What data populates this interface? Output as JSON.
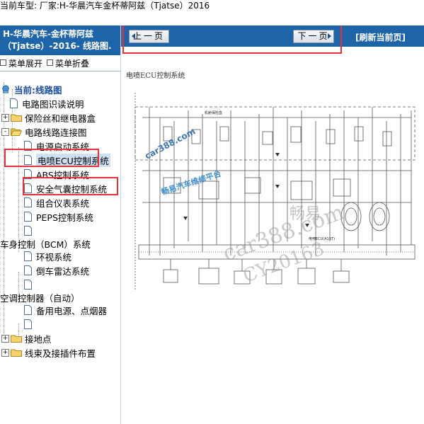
{
  "header": {
    "vehicle_text": "当前车型:  厂家:H-华晨汽车金杯蒂阿兹（Tjatse）2016"
  },
  "left_panel": {
    "title_line1": "H-华晨汽车-金杯蒂阿兹",
    "title_line2": "（Tjatse）-2016- 线路图.",
    "expand_label": "菜单展开",
    "collapse_label": "菜单折叠",
    "tree": [
      {
        "label": "当前:线路图",
        "type": "root"
      },
      {
        "label": "电路图识读说明",
        "type": "doc"
      },
      {
        "label": "保险丝和继电器盒",
        "type": "folder",
        "toggle": "+"
      },
      {
        "label": "电路线路连接图",
        "type": "folder-open",
        "toggle": "-"
      },
      {
        "label": "电源启动系统",
        "type": "doc"
      },
      {
        "label": "电喷ECU控制系统",
        "type": "doc"
      },
      {
        "label": "ABS控制系统",
        "type": "doc"
      },
      {
        "label": "安全气囊控制系统",
        "type": "doc"
      },
      {
        "label": "组合仪表系统",
        "type": "doc"
      },
      {
        "label": "PEPS控制系统",
        "type": "doc"
      },
      {
        "label": "",
        "type": "doc"
      },
      {
        "label": "车身控制（BCM）系统",
        "type": "text"
      },
      {
        "label": "环视系统",
        "type": "doc"
      },
      {
        "label": "倒车雷达系统",
        "type": "doc"
      },
      {
        "label": "",
        "type": "doc"
      },
      {
        "label": "空调控制器（自动）",
        "type": "text"
      },
      {
        "label": "备用电源、点烟器",
        "type": "doc"
      },
      {
        "label": "",
        "type": "doc"
      },
      {
        "label": "接地点",
        "type": "folder",
        "toggle": "+"
      },
      {
        "label": "线束及接插件布置",
        "type": "folder",
        "toggle": "+"
      }
    ]
  },
  "toolbar": {
    "prev_label": "上一页",
    "next_label": "下一页",
    "refresh_label": "[刷新当前页]"
  },
  "diagram": {
    "title": "电喷ECU控制系统",
    "inner_label_top": "机舱保险盒",
    "inner_label_ecu": "电喷ECU(A15T)"
  },
  "watermarks": {
    "wm1": "car388.com",
    "wm2": "畅易汽车维修平台",
    "wm3": "畅易",
    "wm4": "car388.com",
    "wm5": "CY20163"
  },
  "colors": {
    "accent_blue": "#1e64a8",
    "highlight_red": "#e8323a",
    "tree_current": "#1c4fa0",
    "selection_bg": "#cfe0f3"
  }
}
